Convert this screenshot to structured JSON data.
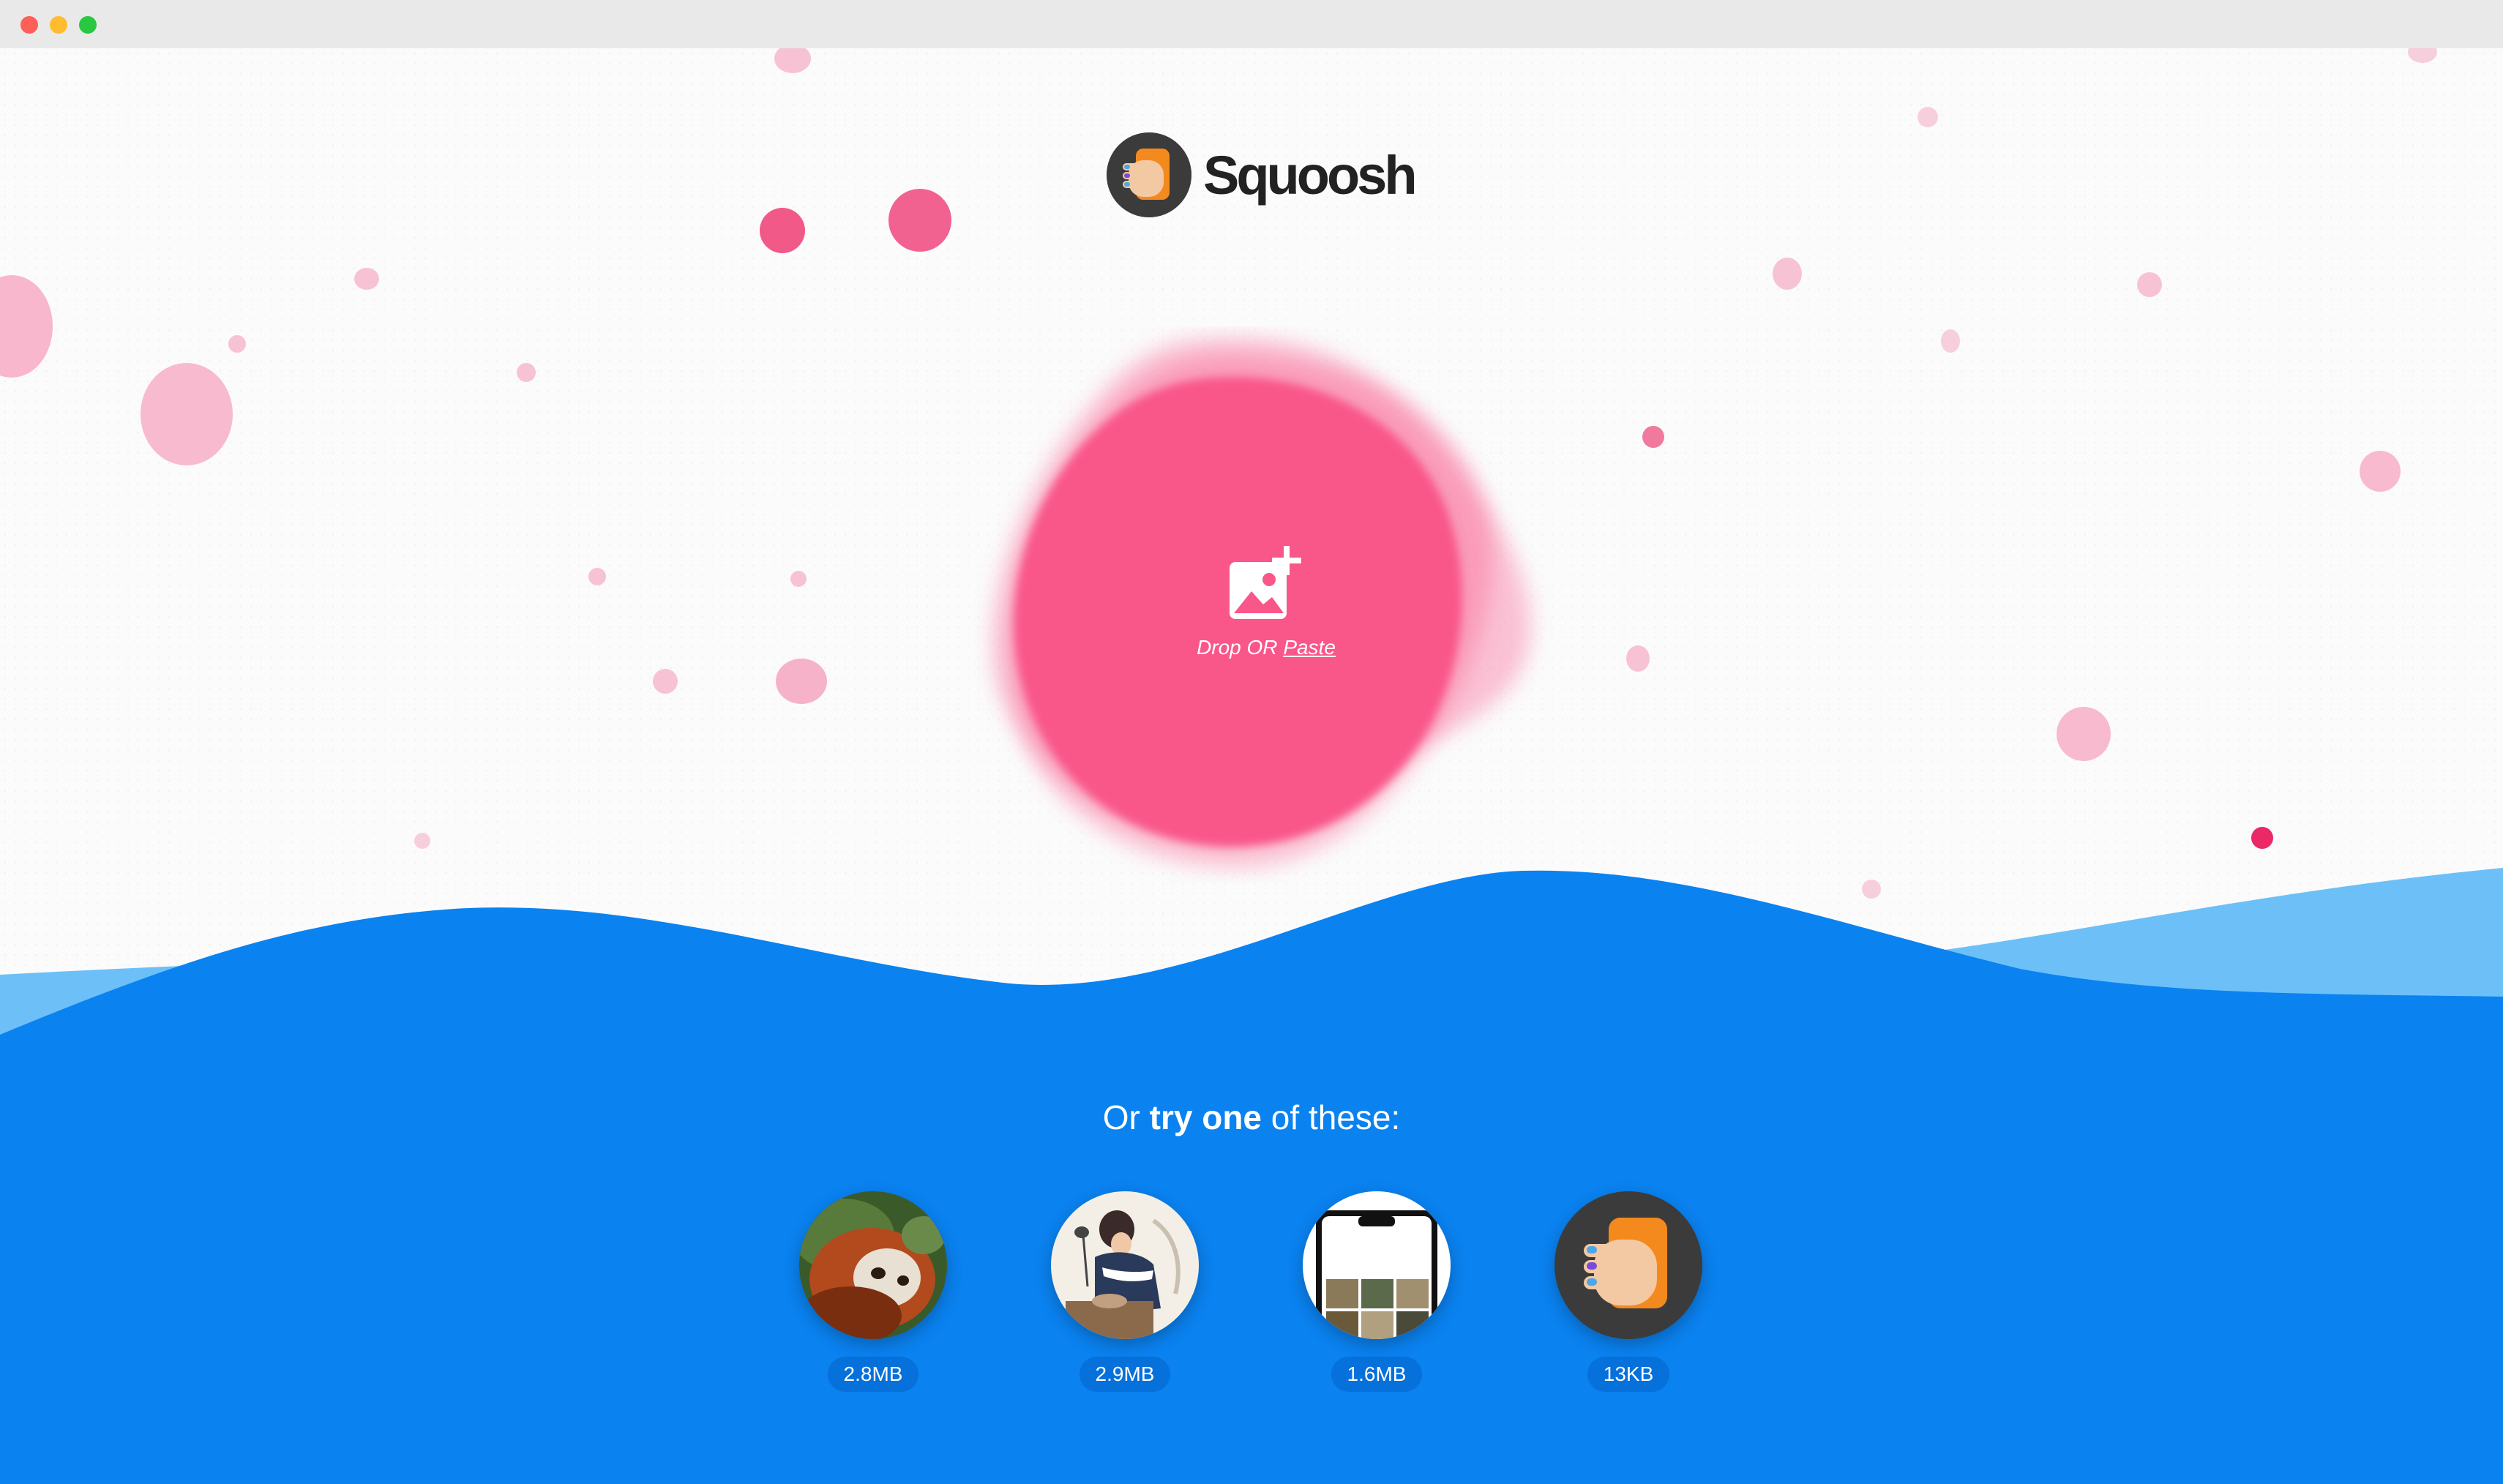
{
  "app": {
    "name": "Squoosh"
  },
  "dropzone": {
    "drop_label": "Drop OR ",
    "paste_label": "Paste"
  },
  "intro": {
    "prefix": "Or ",
    "emphasis": "try one",
    "suffix": " of these:"
  },
  "demos": [
    {
      "size": "2.8MB",
      "icon": "red-panda-photo"
    },
    {
      "size": "2.9MB",
      "icon": "artwork-illustration"
    },
    {
      "size": "1.6MB",
      "icon": "device-screen-photo"
    },
    {
      "size": "13KB",
      "icon": "squoosh-logo-icon"
    }
  ],
  "colors": {
    "blob_pink": "#f9568a",
    "wave_blue": "#0a82f0",
    "wave_light_blue": "#6cc0f7",
    "background": "#fbfbfb"
  }
}
